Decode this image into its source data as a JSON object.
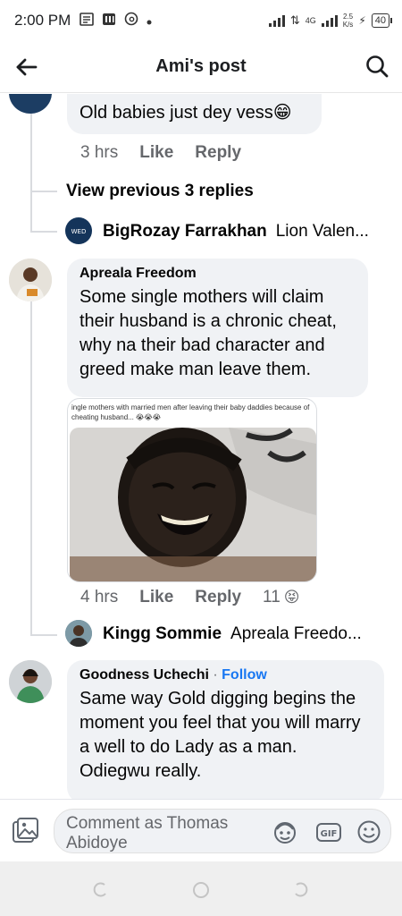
{
  "status_bar": {
    "time": "2:00 PM",
    "network_label": "4G",
    "speed_value": "2.5",
    "speed_unit": "K/s",
    "battery": "40"
  },
  "header": {
    "title": "Ami's post"
  },
  "comments": {
    "top_reply": {
      "text": "Old babies just dey vess😁",
      "time": "3 hrs",
      "like": "Like",
      "reply": "Reply"
    },
    "view_previous": "View previous 3 replies",
    "reply_preview_1": {
      "name": "BigRozay Farrakhan",
      "snippet": "Lion Valen..."
    },
    "comment_1": {
      "author": "Apreala Freedom",
      "text": "Some single mothers will claim their husband is a chronic cheat, why na their bad character and greed make man leave them.",
      "image_caption": "ingle mothers with married men after leaving their baby daddies because of cheating husband... 😭😭😭",
      "time": "4 hrs",
      "like": "Like",
      "reply": "Reply",
      "reaction_count": "11",
      "reaction_emoji": "😝"
    },
    "reply_preview_2": {
      "name": "Kingg Sommie",
      "snippet": "Apreala Freedo..."
    },
    "comment_2": {
      "author": "Goodness Uchechi",
      "separator": "·",
      "follow": "Follow",
      "text": "Same way Gold digging begins the moment you feel that you will marry a well to do Lady as a man. Odiegwu really."
    }
  },
  "composer": {
    "placeholder": "Comment as Thomas Abidoye",
    "gif_label": "GIF"
  },
  "colors": {
    "bubble": "#f0f2f5",
    "link_blue": "#1877f2",
    "meta_grey": "#65676b"
  }
}
